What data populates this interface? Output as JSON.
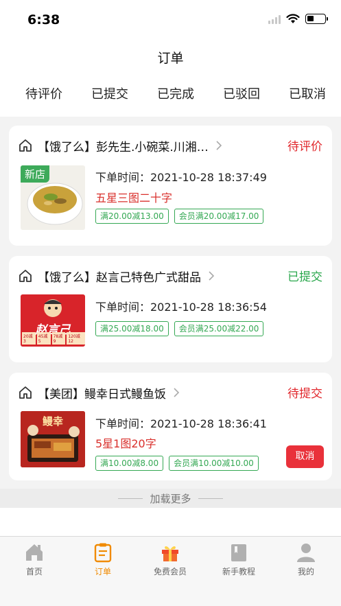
{
  "status_bar": {
    "time": "6:38"
  },
  "header": {
    "title": "订单"
  },
  "tabs": [
    {
      "label": "待评价"
    },
    {
      "label": "已提交"
    },
    {
      "label": "已完成"
    },
    {
      "label": "已驳回"
    },
    {
      "label": "已取消"
    }
  ],
  "orders": [
    {
      "shop": "【饿了么】彭先生.小碗菜.川湘…",
      "status": "待评价",
      "badge": "新店",
      "order_time": "下单时间：2021-10-28 18:37:49",
      "review": "五星三图二十字",
      "tags": [
        "满20.00减13.00",
        "会员满20.00减17.00"
      ]
    },
    {
      "shop": "【饿了么】赵言己特色广式甜品",
      "status": "已提交",
      "brand": "赵言己",
      "coupons": [
        "20减3",
        "45减5",
        "78减9",
        "120减12"
      ],
      "order_time": "下单时间：2021-10-28 18:36:54",
      "tags": [
        "满25.00减18.00",
        "会员满25.00减22.00"
      ]
    },
    {
      "shop": "【美团】鳗幸日式鳗鱼饭",
      "status": "待提交",
      "brand": "鳗幸",
      "order_time": "下单时间：2021-10-28 18:36:41",
      "review": "5星1图20字",
      "tags": [
        "满10.00减8.00",
        "会员满10.00减10.00"
      ],
      "cancel_label": "取消"
    }
  ],
  "load_more": "加载更多",
  "tabbar": [
    {
      "label": "首页",
      "icon": "home-icon"
    },
    {
      "label": "订单",
      "icon": "order-icon",
      "active": true
    },
    {
      "label": "免费会员",
      "icon": "gift-icon"
    },
    {
      "label": "新手教程",
      "icon": "book-icon"
    },
    {
      "label": "我的",
      "icon": "profile-icon"
    }
  ],
  "colors": {
    "accent": "#f08a00",
    "status_red": "#e1262b",
    "status_green": "#2aa74c",
    "tag_green": "#34a853",
    "cancel_red": "#e9313a"
  }
}
